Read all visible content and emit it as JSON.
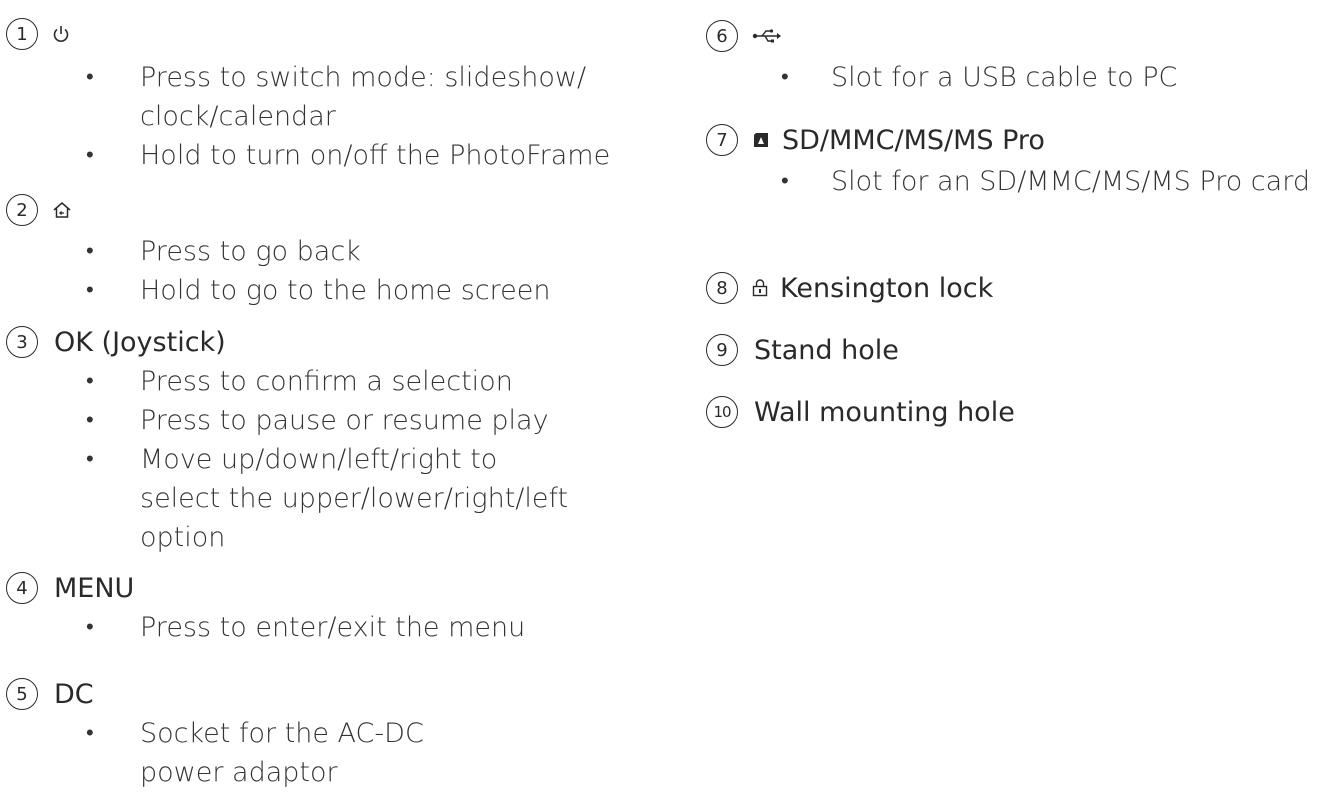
{
  "left": [
    {
      "number": "1",
      "icon": "power-icon",
      "label": "",
      "bullets": [
        "Press to switch mode: slideshow/ clock/calendar",
        "Hold to turn on/off the PhotoFrame"
      ]
    },
    {
      "number": "2",
      "icon": "home-back-icon",
      "label": "",
      "bullets": [
        "Press to go back",
        "Hold to go to the home screen"
      ]
    },
    {
      "number": "3",
      "icon": "",
      "label": "OK (Joystick)",
      "bullets": [
        "Press to confirm a selection",
        "Press to pause or resume play",
        "Move up/down/left/right to select the upper/lower/right/left option"
      ]
    },
    {
      "number": "4",
      "icon": "",
      "label": "MENU",
      "bullets": [
        "Press to enter/exit the menu"
      ]
    },
    {
      "number": "5",
      "icon": "",
      "label": "DC",
      "bullets": [
        "Socket for the AC-DC power adaptor"
      ]
    }
  ],
  "right": [
    {
      "number": "6",
      "icon": "usb-icon",
      "label": "",
      "bullets": [
        "Slot for a USB cable to PC"
      ]
    },
    {
      "number": "7",
      "icon": "sd-card-icon",
      "label": "SD/MMC/MS/MS Pro",
      "bullets": [
        "Slot for an SD/MMC/MS/MS Pro card"
      ]
    },
    {
      "number": "8",
      "icon": "lock-icon",
      "label": "Kensington lock",
      "bullets": []
    },
    {
      "number": "9",
      "icon": "",
      "label": "Stand hole",
      "bullets": []
    },
    {
      "number": "10",
      "icon": "",
      "label": "Wall mounting hole",
      "bullets": []
    }
  ]
}
